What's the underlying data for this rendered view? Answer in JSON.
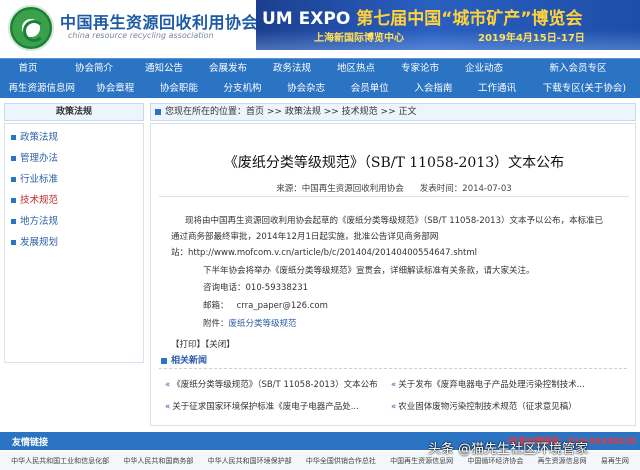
{
  "header": {
    "title": "中国再生资源回收利用协会",
    "subtitle": "china resource recycling association"
  },
  "banner": {
    "main_prefix": "UM EXPO ",
    "main_highlight": "第七届中国“城市矿产”博览会",
    "sub": "上海新国际博览中心",
    "date": "2019年4月15日-17日"
  },
  "nav": {
    "row1": [
      "首页",
      "协会简介",
      "通知公告",
      "会展发布",
      "政务法规",
      "地区热点",
      "专家论市",
      "企业动态",
      "新入会员专区"
    ],
    "row2": [
      "再生资源信息网",
      "协会章程",
      "协会职能",
      "分支机构",
      "协会杂志",
      "会员单位",
      "入会指南",
      "工作通讯",
      "下载专区(关于协会)"
    ]
  },
  "left_head": "政策法规",
  "breadcrumb": {
    "prefix": "您现在所在的位置：",
    "items": [
      "首页",
      "政策法规",
      "技术规范",
      "正文"
    ],
    "sep": " >> "
  },
  "sidebar": {
    "items": [
      {
        "label": "政策法规",
        "active": false
      },
      {
        "label": "管理办法",
        "active": false
      },
      {
        "label": "行业标准",
        "active": false
      },
      {
        "label": "技术规范",
        "active": true
      },
      {
        "label": "地方法规",
        "active": false
      },
      {
        "label": "发展规划",
        "active": false
      }
    ]
  },
  "article": {
    "title": "《废纸分类等级规范》（SB/T 11058-2013）文本公布",
    "source": "来源：中国再生资源回收利用协会",
    "time": "发表时间：2014-07-03",
    "p1_line1": "现将由中国再生资源回收利用协会起草的《废纸分类等级规范》（SB/T 11058-2013）文本予以公布，本标准已",
    "p1_line2": "通过商务部最终审批，2014年12月1日起实施，批准公告详见商务部网",
    "p1_line3": "站：http://www.mofcom.v.cn/article/b/c/201404/20140400554647.shtml",
    "p2": "下半年协会将举办《废纸分类等级规范》宣贯会，详细解读标准有关条款，请大家关注。",
    "phone": "咨询电话：010-59338231",
    "email_label": "邮箱：",
    "email": "crra_paper@126.com",
    "attach_label": "附件：",
    "attach": "废纸分类等级规范",
    "buttons": "【打印】【关闭】",
    "related_title": "相关新闻",
    "related": [
      "《废纸分类等级规范》（SB/T 11058-2013）文本公布",
      "关于发布《废弃电器电子产品处理污染控制技术...",
      "关于征求国家环境保护标准《废电子电器产品处...",
      "农业固体废物污染控制技术规范（征求意见稿）"
    ]
  },
  "footer": {
    "friend_label": "友情链接",
    "contact": "申请友情链接：010-59338230",
    "links": [
      "中华人民共和国工业和信息化部",
      "中华人民共和国商务部",
      "中华人民共和国环境保护部",
      "中华全国供销合作总社",
      "中国再生资源信息网",
      "中国循环经济协会",
      "再生资源信息网",
      "易再生网"
    ]
  },
  "watermark": "头条 @猫先生社区环境管家"
}
